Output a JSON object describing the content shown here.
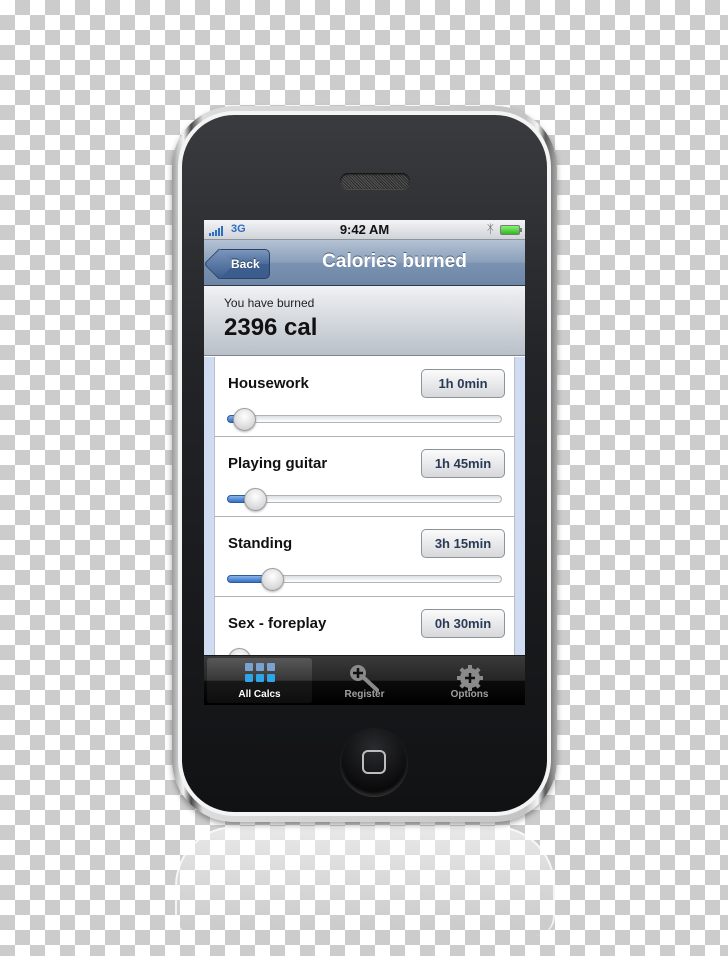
{
  "status_bar": {
    "carrier": "3G",
    "time": "9:42 AM",
    "bluetooth_icon": "bluetooth-icon",
    "battery_icon": "battery-icon",
    "signal_icon": "signal-bars-icon"
  },
  "nav": {
    "back_label": "Back",
    "title": "Calories burned"
  },
  "summary": {
    "label": "You have burned",
    "value": "2396 cal"
  },
  "activities": [
    {
      "label": "Housework",
      "duration": "1h 0min",
      "slider_fraction": 0.06
    },
    {
      "label": "Playing guitar",
      "duration": "1h 45min",
      "slider_fraction": 0.1
    },
    {
      "label": "Standing",
      "duration": "3h 15min",
      "slider_fraction": 0.16
    },
    {
      "label": "Sex - foreplay",
      "duration": "0h 30min",
      "slider_fraction": 0.04
    }
  ],
  "tab_bar": {
    "tabs": [
      {
        "label": "All Calcs",
        "icon": "grid-icon",
        "active": true
      },
      {
        "label": "Register",
        "icon": "key-add-icon",
        "active": false
      },
      {
        "label": "Options",
        "icon": "gear-add-icon",
        "active": false
      }
    ]
  }
}
